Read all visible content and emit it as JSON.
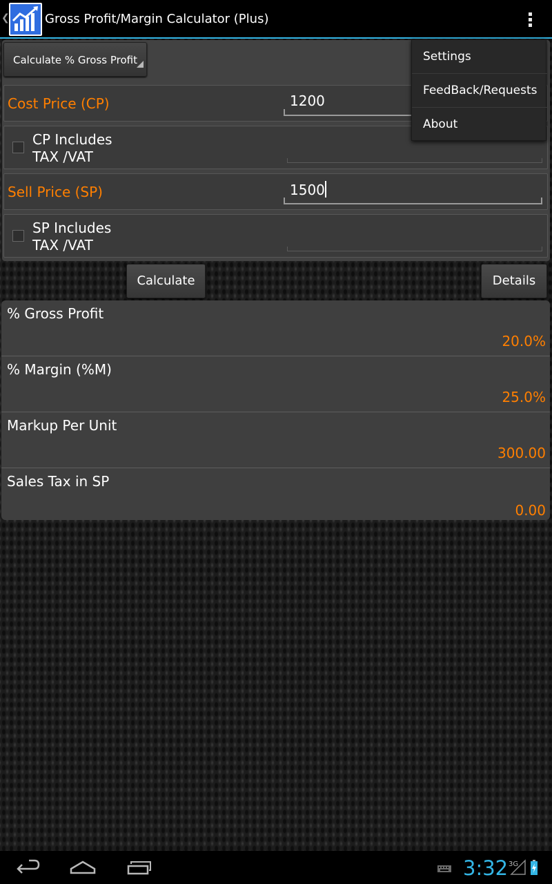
{
  "app": {
    "title": "Gross Profit/Margin Calculator (Plus)"
  },
  "mode": {
    "selected": "Calculate % Gross Profit"
  },
  "inputs": {
    "cost_price_label": "Cost Price (CP)",
    "cost_price_value": "1200",
    "cp_tax_label_line1": "CP Includes",
    "cp_tax_label_line2": "TAX /VAT",
    "cp_tax_checked": false,
    "sell_price_label": "Sell Price (SP)",
    "sell_price_value": "1500",
    "sp_tax_label_line1": "SP Includes",
    "sp_tax_label_line2": "TAX /VAT",
    "sp_tax_checked": false
  },
  "buttons": {
    "calculate": "Calculate",
    "details": "Details"
  },
  "results": [
    {
      "label": "% Gross Profit",
      "value": "20.0%"
    },
    {
      "label": "% Margin (%M)",
      "value": "25.0%"
    },
    {
      "label": "Markup Per Unit",
      "value": "300.00"
    },
    {
      "label": "Sales Tax in SP",
      "value": "0.00"
    }
  ],
  "menu": {
    "items": [
      "Settings",
      "FeedBack/Requests",
      "About"
    ]
  },
  "status": {
    "time": "3:32",
    "network": "3G"
  },
  "colors": {
    "accent": "#ff7f00",
    "holo_blue": "#33b5e5",
    "app_icon": "#2f6de0"
  },
  "icons": {
    "app": "bar-chart-trend-icon",
    "overflow": "overflow-menu-icon",
    "back": "back-icon",
    "home": "home-icon",
    "recents": "recent-apps-icon",
    "keyboard": "keyboard-icon",
    "signal": "signal-icon",
    "battery": "battery-charging-icon"
  }
}
